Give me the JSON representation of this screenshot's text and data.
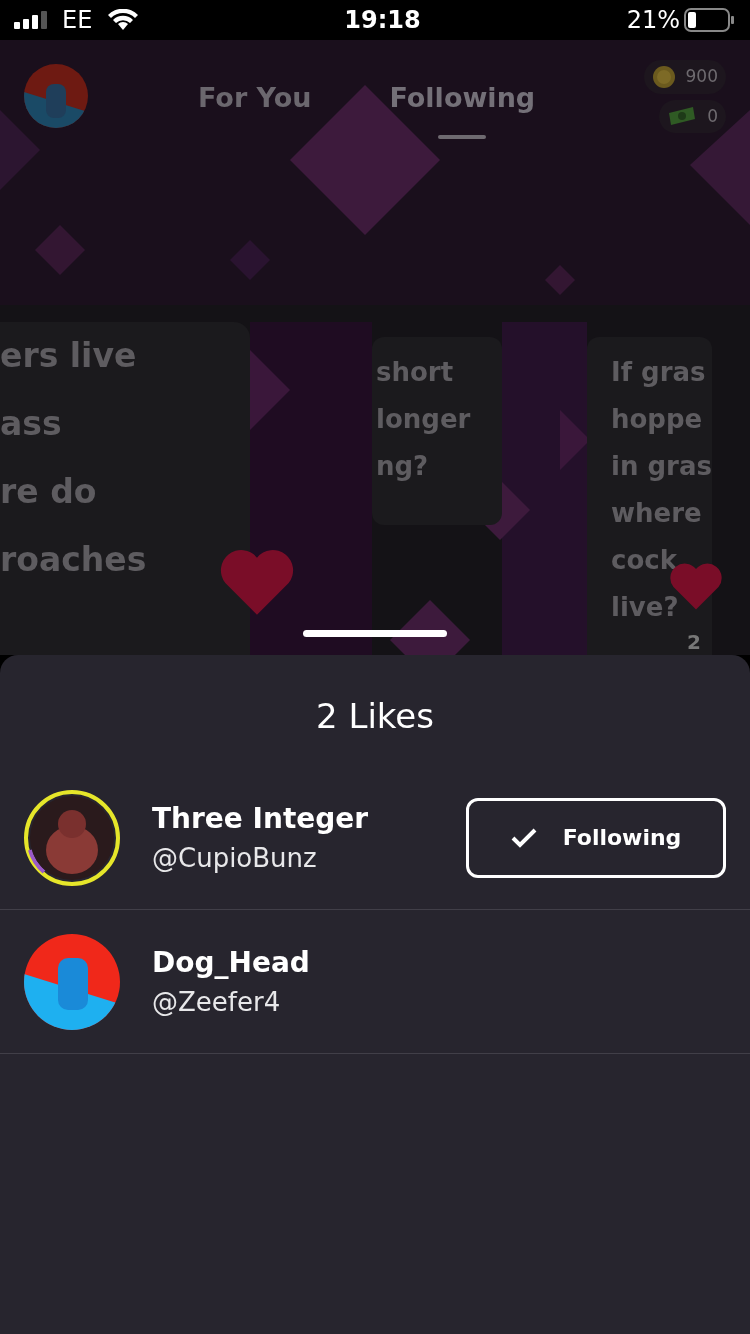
{
  "status_bar": {
    "carrier": "EE",
    "time": "19:18",
    "battery": "21%"
  },
  "header": {
    "tabs": [
      {
        "label": "For You",
        "selected": false
      },
      {
        "label": "Following",
        "selected": true
      }
    ],
    "balances": [
      {
        "kind": "coin",
        "amount": "900"
      },
      {
        "kind": "cash",
        "amount": "0"
      }
    ]
  },
  "feed": {
    "cards": [
      {
        "lines": [
          "ers live",
          "ass",
          "re do",
          "roaches"
        ],
        "liked": true
      },
      {
        "lines": [
          "short",
          "longer",
          "ng?"
        ],
        "liked": false
      },
      {
        "lines": [
          "If gras",
          "hoppe",
          "in gras",
          "where",
          "cock",
          "live?"
        ],
        "liked": true,
        "likes": "2"
      }
    ]
  },
  "likes_sheet": {
    "title": "2 Likes",
    "users": [
      {
        "name": "Three Integer",
        "handle": "@CupioBunz",
        "following_button": {
          "label": "Following",
          "checked": true
        }
      },
      {
        "name": "Dog_Head",
        "handle": "@Zeefer4"
      }
    ]
  }
}
